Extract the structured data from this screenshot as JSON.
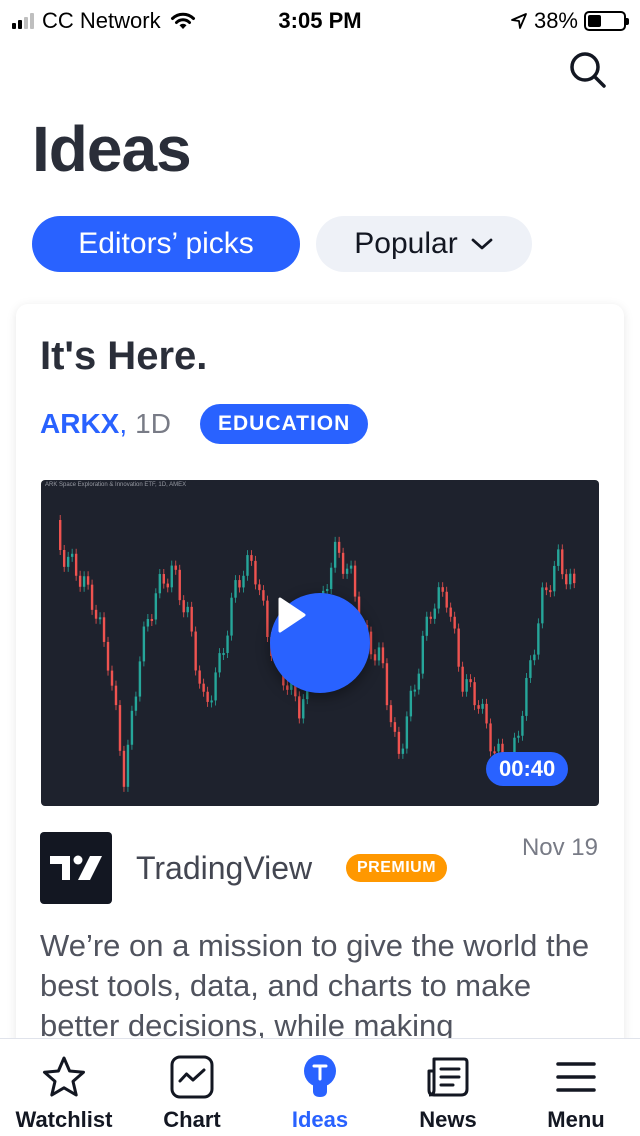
{
  "status_bar": {
    "carrier": "CC Network",
    "time": "3:05 PM",
    "battery": "38%",
    "battery_level": 0.38,
    "icons": [
      "signal-icon",
      "wifi-icon",
      "location-arrow-icon",
      "battery-icon"
    ]
  },
  "header": {
    "title": "Ideas",
    "search_icon": "search-icon"
  },
  "filters": {
    "editors_picks": "Editors’ picks",
    "popular": "Popular",
    "popular_icon": "chevron-down-icon",
    "active": "editors_picks"
  },
  "idea": {
    "title": "It's Here.",
    "symbol": "ARKX",
    "separator": ",",
    "interval": "1D",
    "category": "EDUCATION",
    "chart_caption": "ARK Space Exploration & Innovation ETF, 1D, AMEX",
    "video_duration": "00:40",
    "play_icon": "play-icon",
    "author": "TradingView",
    "author_badge": "PREMIUM",
    "author_logo": "tradingview-logo",
    "date": "Nov 19",
    "description": "We’re on a mission to give the world the best tools, data, and charts to make better decisions, while making"
  },
  "tab_bar": {
    "active": "ideas",
    "tabs": [
      {
        "id": "watchlist",
        "label": "Watchlist",
        "icon": "star-icon"
      },
      {
        "id": "chart",
        "label": "Chart",
        "icon": "chart-icon"
      },
      {
        "id": "ideas",
        "label": "Ideas",
        "icon": "lightbulb-icon"
      },
      {
        "id": "news",
        "label": "News",
        "icon": "news-icon"
      },
      {
        "id": "menu",
        "label": "Menu",
        "icon": "menu-icon"
      }
    ]
  },
  "colors": {
    "accent": "#2962ff",
    "premium": "#ff9800",
    "candle_up": "#26a69a",
    "candle_down": "#ef5350",
    "chart_bg": "#1e222d"
  }
}
